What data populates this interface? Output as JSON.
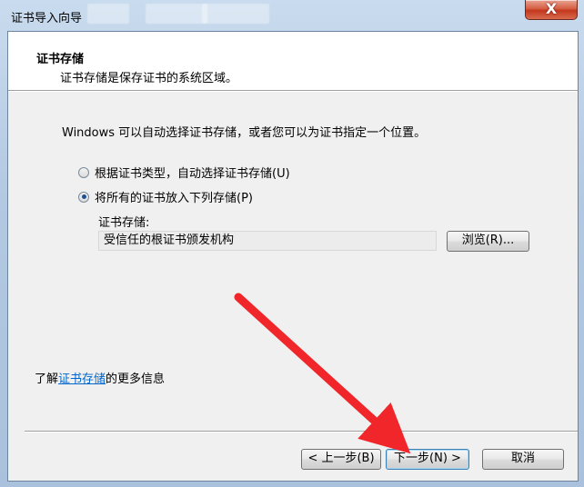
{
  "window": {
    "title": "证书导入向导",
    "close_symbol": "X"
  },
  "header": {
    "title": "证书存储",
    "subtitle": "证书存储是保存证书的系统区域。"
  },
  "body": {
    "description": "Windows 可以自动选择证书存储，或者您可以为证书指定一个位置。",
    "options": [
      {
        "label": "根据证书类型，自动选择证书存储(U)",
        "checked": false
      },
      {
        "label": "将所有的证书放入下列存储(P)",
        "checked": true
      }
    ],
    "store_label": "证书存储:",
    "store_value": "受信任的根证书颁发机构",
    "browse_label": "浏览(R)...",
    "more_info_prefix": "了解",
    "more_info_link": "证书存储",
    "more_info_suffix": "的更多信息"
  },
  "footer": {
    "back_label": "< 上一步(B)",
    "next_label": "下一步(N) >",
    "cancel_label": "取消"
  },
  "colors": {
    "arrow": "#f0262a",
    "link": "#0066cc",
    "radio_dot": "#1e4f91"
  }
}
